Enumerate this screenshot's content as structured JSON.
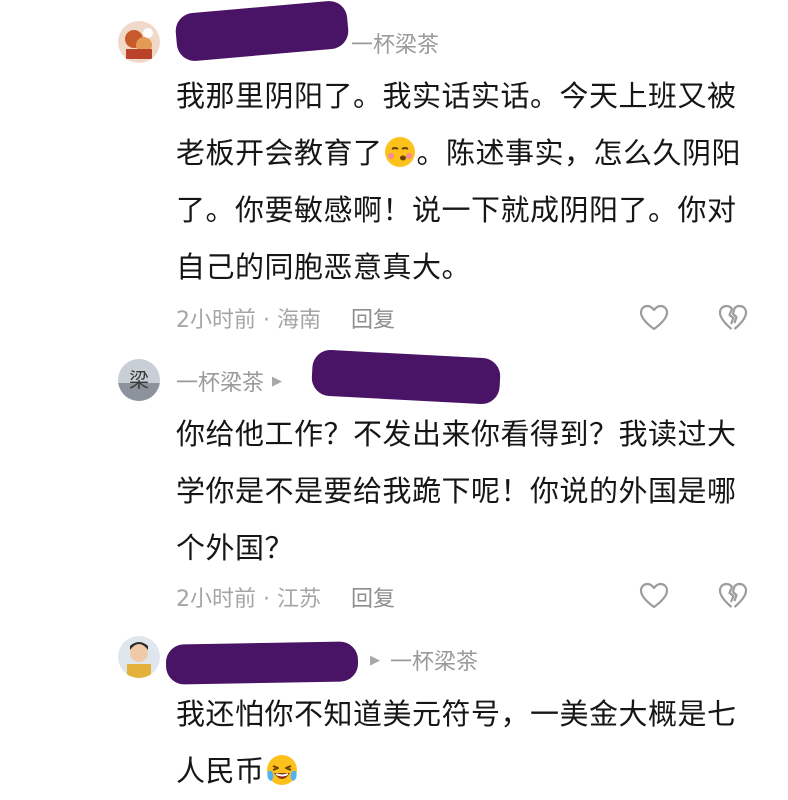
{
  "comments": [
    {
      "name_visible": "",
      "reply_to": "一杯梁茶",
      "text_line_1": "我那里阴阳了。我实话实话。今天上班又被",
      "text_line_2a": "老板开会教育了",
      "text_line_2b": "。陈述事实，怎么久阴阳",
      "text_line_3": "了。你要敏感啊！说一下就成阴阳了。你对",
      "text_line_4": "自己的同胞恶意真大。",
      "emoji_1": "smirk-emoji",
      "time_location": "2小时前 · 海南",
      "reply_label": "回复"
    },
    {
      "name": "一杯梁茶",
      "reply_to": "",
      "text_line_1": "你给他工作？不发出来你看得到？我读过大",
      "text_line_2": "学你是不是要给我跪下呢！你说的外国是哪",
      "text_line_3": "个外国？",
      "time_location": "2小时前 · 江苏",
      "reply_label": "回复"
    },
    {
      "name_visible": "",
      "reply_to": "一杯梁茶",
      "text_line_1": "我还怕你不知道美元符号，一美金大概是七",
      "text_line_2": "人民币",
      "emoji_2": "crying-laughing-emoji"
    }
  ],
  "icons": {
    "like": "heart-outline-icon",
    "dislike": "broken-heart-icon",
    "reply_arrow": "triangle-right-icon"
  },
  "colors": {
    "redaction": "#4a1466",
    "meta_text": "#a5a5a5",
    "body_text": "#161616"
  }
}
